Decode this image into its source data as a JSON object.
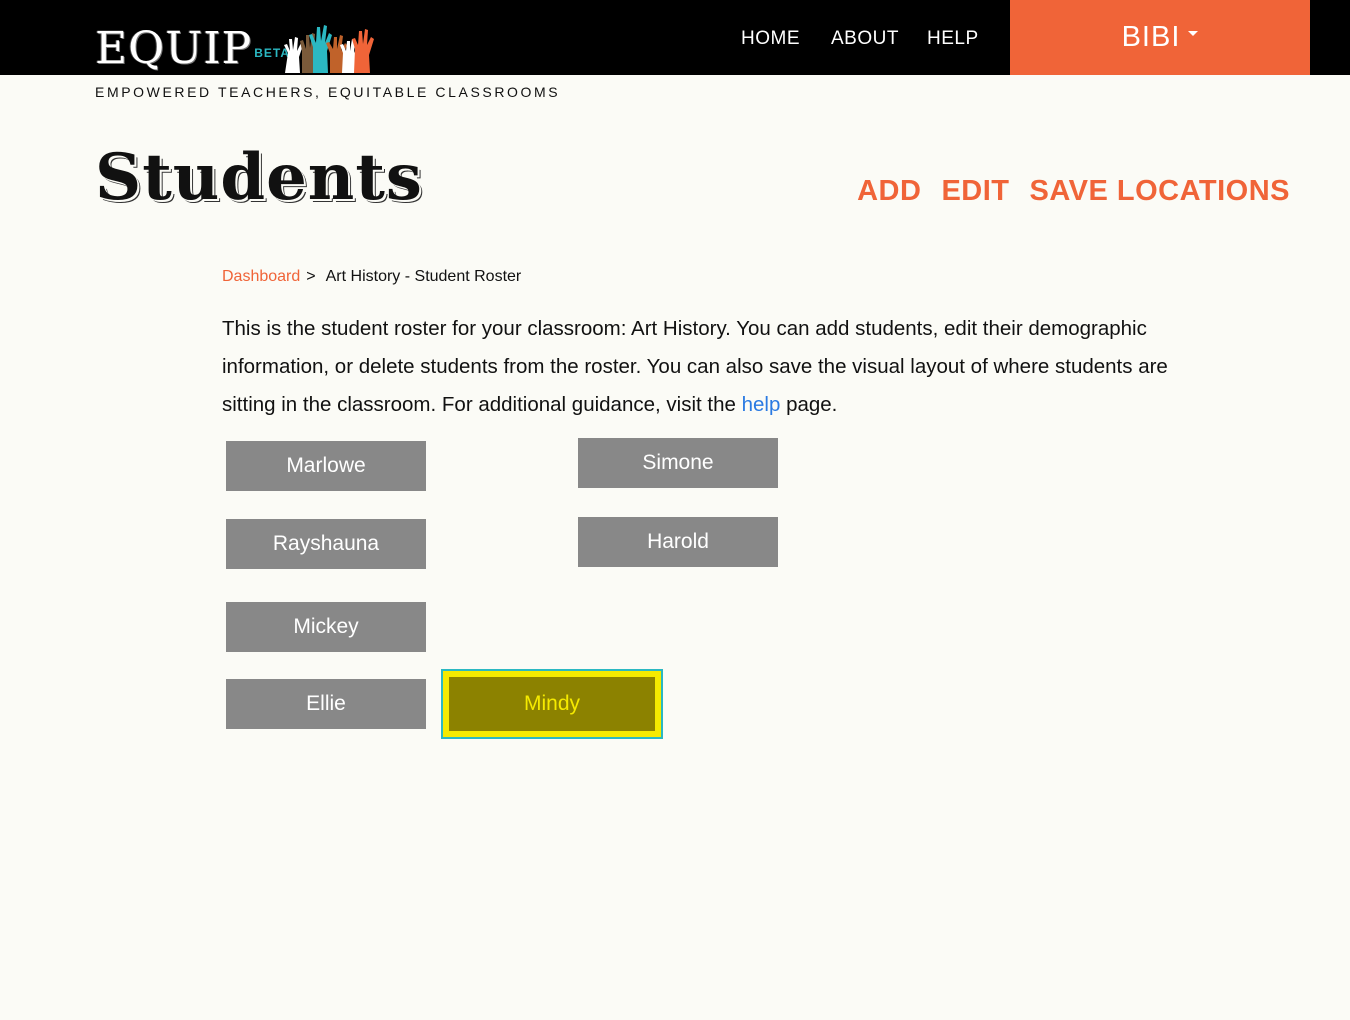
{
  "header": {
    "logo_text": "EQUIP",
    "logo_badge": "BETA",
    "tagline": "EMPOWERED TEACHERS, EQUITABLE CLASSROOMS",
    "nav": [
      "HOME",
      "ABOUT",
      "HELP"
    ],
    "user": "BIBI"
  },
  "page": {
    "title": "Students",
    "actions": [
      "ADD",
      "EDIT",
      "SAVE LOCATIONS"
    ]
  },
  "breadcrumb": {
    "link": "Dashboard",
    "separator": ">",
    "current": "Art History - Student Roster"
  },
  "intro": {
    "text_before": "This is the student roster for your classroom: Art History. You can add students, edit their demographic information, or delete students from the roster. You can also save the visual layout of where students are sitting in the classroom. For additional guidance, visit the ",
    "link": "help",
    "text_after": " page."
  },
  "students": [
    {
      "name": "Marlowe",
      "selected": false
    },
    {
      "name": "Simone",
      "selected": false
    },
    {
      "name": "Rayshauna",
      "selected": false
    },
    {
      "name": "Harold",
      "selected": false
    },
    {
      "name": "Mickey",
      "selected": false
    },
    {
      "name": "Ellie",
      "selected": false
    },
    {
      "name": "Mindy",
      "selected": true
    }
  ],
  "colors": {
    "accent": "#f06438",
    "link": "#2a7ae2",
    "student_tile": "#888888",
    "selected_fill": "#8c8200",
    "selected_border": "#f5ea00",
    "selected_outline": "#2bb8c2"
  }
}
